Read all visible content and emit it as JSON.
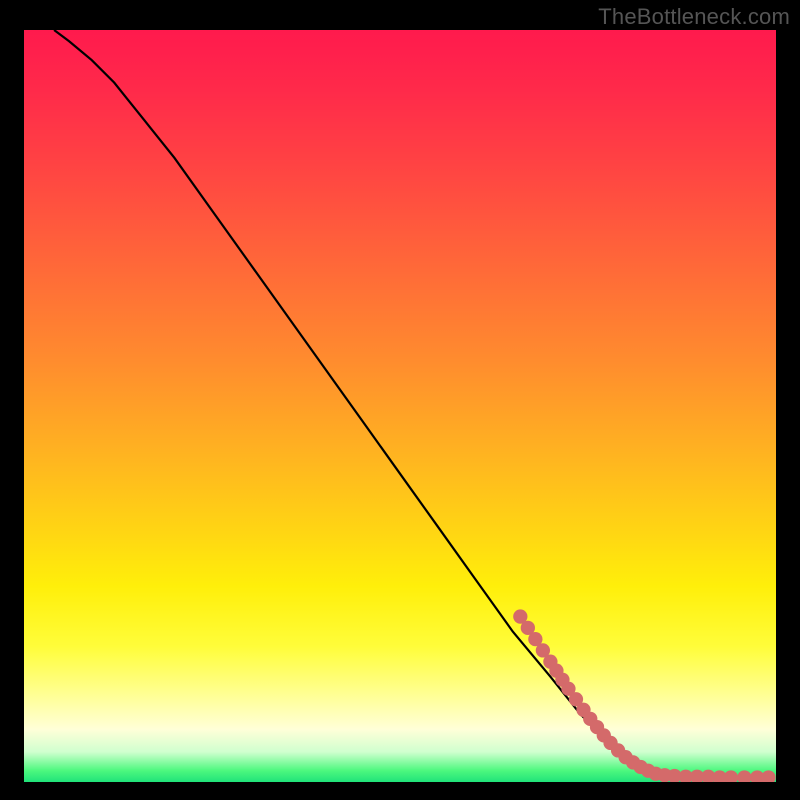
{
  "attribution": "TheBottleneck.com",
  "chart_data": {
    "type": "line",
    "title": "",
    "xlabel": "",
    "ylabel": "",
    "xlim": [
      0,
      100
    ],
    "ylim": [
      0,
      100
    ],
    "grid": false,
    "legend": false,
    "curve": [
      {
        "x": 4,
        "y": 100
      },
      {
        "x": 6,
        "y": 98.5
      },
      {
        "x": 9,
        "y": 96
      },
      {
        "x": 12,
        "y": 93
      },
      {
        "x": 16,
        "y": 88
      },
      {
        "x": 20,
        "y": 83
      },
      {
        "x": 25,
        "y": 76
      },
      {
        "x": 30,
        "y": 69
      },
      {
        "x": 35,
        "y": 62
      },
      {
        "x": 40,
        "y": 55
      },
      {
        "x": 45,
        "y": 48
      },
      {
        "x": 50,
        "y": 41
      },
      {
        "x": 55,
        "y": 34
      },
      {
        "x": 60,
        "y": 27
      },
      {
        "x": 65,
        "y": 20
      },
      {
        "x": 70,
        "y": 14
      },
      {
        "x": 74,
        "y": 9
      },
      {
        "x": 78,
        "y": 5
      },
      {
        "x": 81,
        "y": 2.5
      },
      {
        "x": 84,
        "y": 1.2
      },
      {
        "x": 88,
        "y": 0.7
      },
      {
        "x": 92,
        "y": 0.6
      },
      {
        "x": 96,
        "y": 0.6
      },
      {
        "x": 99,
        "y": 0.6
      }
    ],
    "dots": [
      {
        "x": 66,
        "y": 22
      },
      {
        "x": 67,
        "y": 20.5
      },
      {
        "x": 68,
        "y": 19
      },
      {
        "x": 69,
        "y": 17.5
      },
      {
        "x": 70,
        "y": 16
      },
      {
        "x": 70.8,
        "y": 14.8
      },
      {
        "x": 71.6,
        "y": 13.6
      },
      {
        "x": 72.4,
        "y": 12.4
      },
      {
        "x": 73.4,
        "y": 11
      },
      {
        "x": 74.4,
        "y": 9.6
      },
      {
        "x": 75.3,
        "y": 8.4
      },
      {
        "x": 76.2,
        "y": 7.3
      },
      {
        "x": 77.1,
        "y": 6.2
      },
      {
        "x": 78.0,
        "y": 5.2
      },
      {
        "x": 79.0,
        "y": 4.2
      },
      {
        "x": 80.0,
        "y": 3.3
      },
      {
        "x": 81.0,
        "y": 2.6
      },
      {
        "x": 82.0,
        "y": 2.0
      },
      {
        "x": 83.0,
        "y": 1.5
      },
      {
        "x": 84.0,
        "y": 1.1
      },
      {
        "x": 85.2,
        "y": 0.9
      },
      {
        "x": 86.5,
        "y": 0.8
      },
      {
        "x": 88.0,
        "y": 0.7
      },
      {
        "x": 89.5,
        "y": 0.7
      },
      {
        "x": 91.0,
        "y": 0.7
      },
      {
        "x": 92.5,
        "y": 0.6
      },
      {
        "x": 94.0,
        "y": 0.6
      },
      {
        "x": 95.8,
        "y": 0.6
      },
      {
        "x": 97.5,
        "y": 0.6
      },
      {
        "x": 99.0,
        "y": 0.6
      }
    ],
    "dot_color": "#d46a6a",
    "line_color": "#000000"
  }
}
